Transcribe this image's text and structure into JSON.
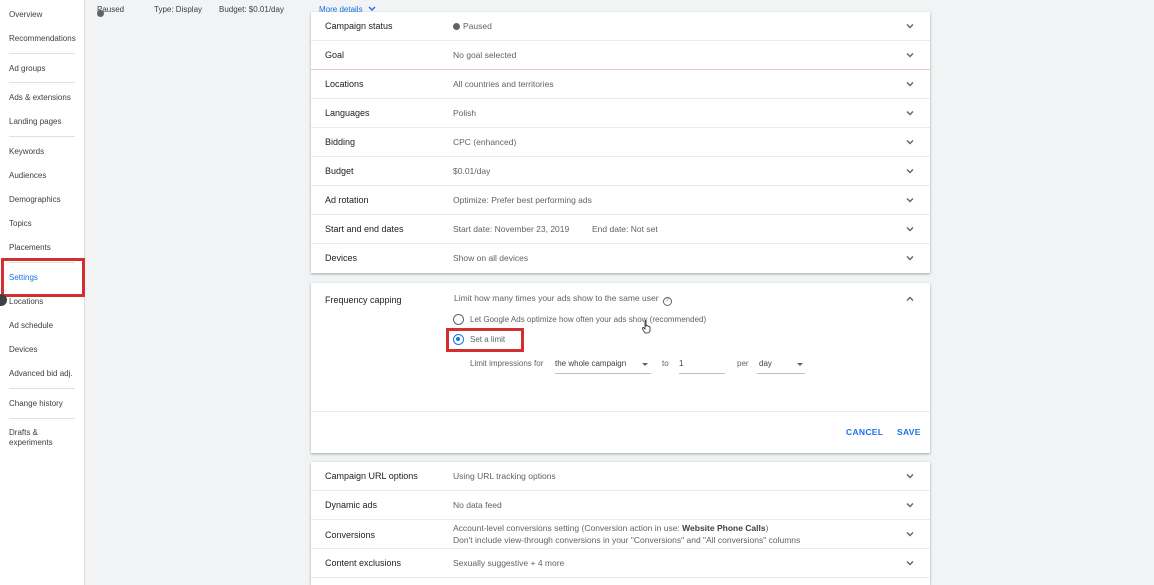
{
  "sidebar": {
    "items": [
      {
        "label": "Overview"
      },
      {
        "label": "Recommendations"
      },
      {
        "label": "Ad groups"
      },
      {
        "label": "Ads & extensions"
      },
      {
        "label": "Landing pages"
      },
      {
        "label": "Keywords"
      },
      {
        "label": "Audiences"
      },
      {
        "label": "Demographics"
      },
      {
        "label": "Topics"
      },
      {
        "label": "Placements"
      },
      {
        "label": "Settings"
      },
      {
        "label": "Locations"
      },
      {
        "label": "Ad schedule"
      },
      {
        "label": "Devices"
      },
      {
        "label": "Advanced bid adj."
      },
      {
        "label": "Change history"
      },
      {
        "label": "Drafts &"
      },
      {
        "label": "experiments"
      }
    ]
  },
  "topstrip": {
    "status": "Paused",
    "type": "Type: Display",
    "budget": "Budget: $0.01/day",
    "more_details": "More details"
  },
  "settings": {
    "rows": [
      {
        "label": "Campaign status",
        "value": "Paused"
      },
      {
        "label": "Goal",
        "value": "No goal selected"
      },
      {
        "label": "Locations",
        "value": "All countries and territories"
      },
      {
        "label": "Languages",
        "value": "Polish"
      },
      {
        "label": "Bidding",
        "value": "CPC (enhanced)"
      },
      {
        "label": "Budget",
        "value": "$0.01/day"
      },
      {
        "label": "Ad rotation",
        "value": "Optimize: Prefer best performing ads"
      },
      {
        "label": "Start and end dates",
        "value": "Start date: November 23, 2019",
        "value2": "End date: Not set"
      },
      {
        "label": "Devices",
        "value": "Show on all devices"
      }
    ]
  },
  "frequency_capping": {
    "title": "Frequency capping",
    "description": "Limit how many times your ads show to the same user",
    "option_auto": "Let Google Ads optimize how often your ads show (recommended)",
    "option_limit": "Set a limit",
    "limit_label": "Limit impressions for",
    "scope_value": "the whole campaign",
    "to_label": "to",
    "count_value": "1",
    "per_label": "per",
    "period_value": "day",
    "cancel": "CANCEL",
    "save": "SAVE"
  },
  "more_settings": {
    "rows": [
      {
        "label": "Campaign URL options",
        "value": "Using URL tracking options"
      },
      {
        "label": "Dynamic ads",
        "value": "No data feed"
      },
      {
        "label": "Conversions",
        "value_prefix": "Account-level conversions setting (Conversion action in use: ",
        "value_bold": "Website Phone Calls",
        "value_suffix": ")",
        "value_line2": "Don't include view-through conversions in your \"Conversions\" and \"All conversions\" columns"
      },
      {
        "label": "Content exclusions",
        "value": "Sexually suggestive + 4 more"
      }
    ]
  },
  "colors": {
    "accent": "#1a73e8",
    "highlight": "#d32f2f"
  }
}
